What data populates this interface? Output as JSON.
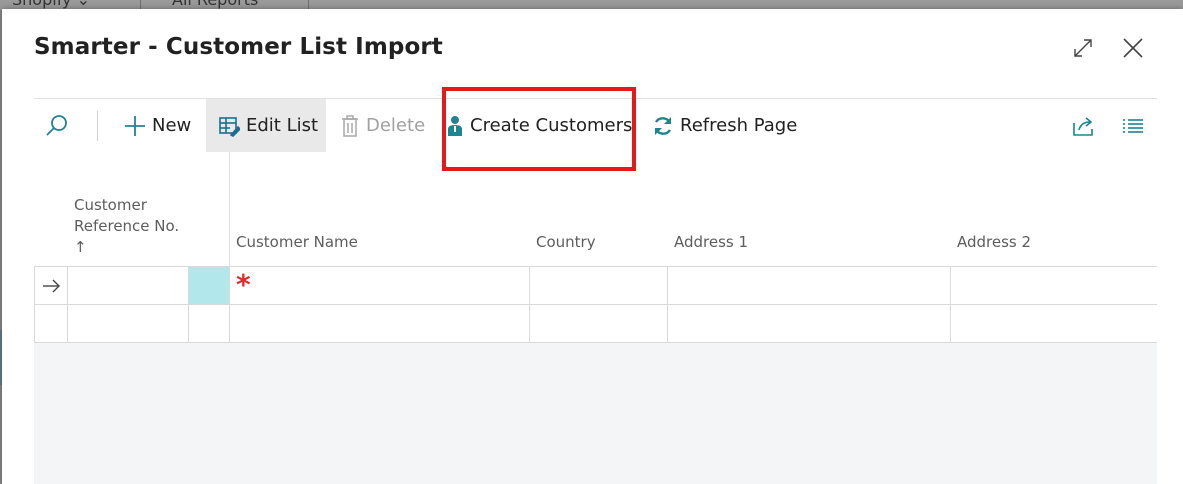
{
  "background": {
    "tabs": [
      "Shopify ⌄",
      "All Reports"
    ]
  },
  "dialog": {
    "title": "Smarter - Customer List Import"
  },
  "toolbar": {
    "new_label": "New",
    "edit_list_label": "Edit List",
    "delete_label": "Delete",
    "create_customers_label": "Create Customers",
    "refresh_label": "Refresh Page"
  },
  "table": {
    "columns": {
      "customer_ref": "Customer Reference No. ↑",
      "customer_name": "Customer Name",
      "country": "Country",
      "address1": "Address 1",
      "address2": "Address 2"
    },
    "rows": [
      {
        "customer_ref": "",
        "customer_name": "",
        "country": "",
        "address1": "",
        "address2": ""
      },
      {
        "customer_ref": "",
        "customer_name": "",
        "country": "",
        "address1": "",
        "address2": ""
      }
    ],
    "required_marker": "*"
  },
  "colors": {
    "accent": "#1b8591",
    "highlight_border": "#e21a1a",
    "selected_cell": "#b2e8ec",
    "required": "#e02b2b"
  },
  "icons": [
    "search-icon",
    "plus-icon",
    "edit-list-icon",
    "trash-icon",
    "person-icon",
    "refresh-icon",
    "share-icon",
    "list-view-icon",
    "expand-icon",
    "close-icon",
    "row-arrow-icon"
  ]
}
